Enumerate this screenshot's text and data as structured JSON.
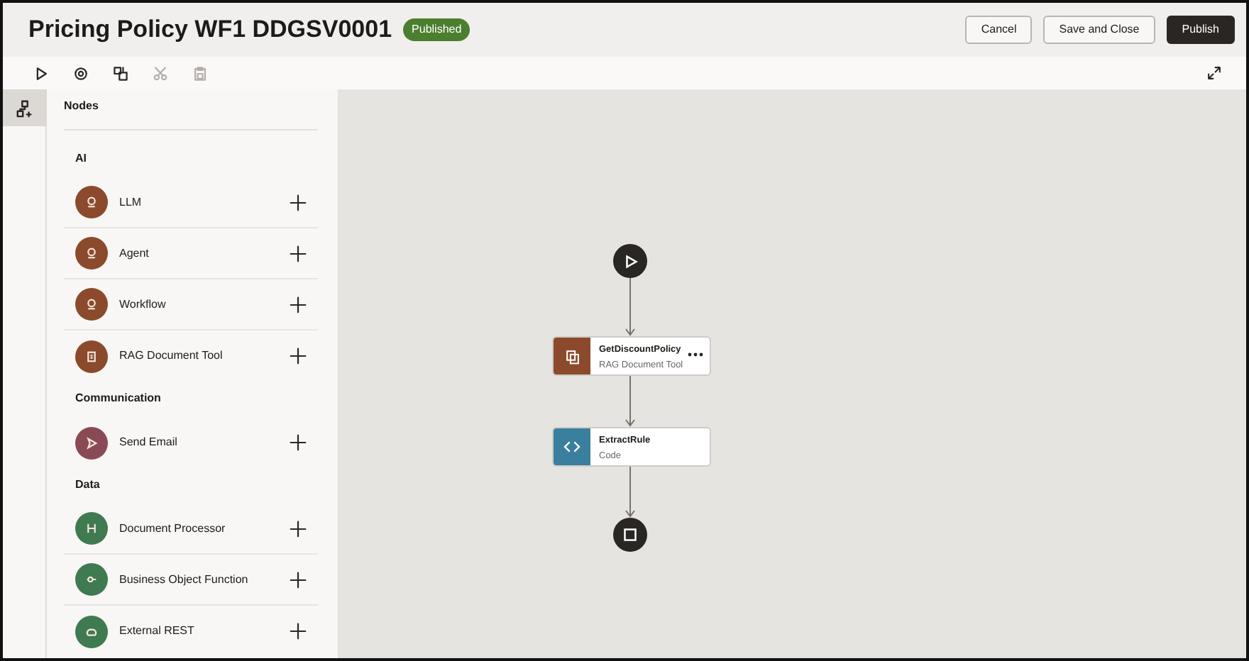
{
  "header": {
    "title": "Pricing Policy WF1 DDGSV0001",
    "status": "Published",
    "buttons": [
      {
        "label": "Cancel",
        "kind": "secondary"
      },
      {
        "label": "Save and Close",
        "kind": "secondary"
      },
      {
        "label": "Publish",
        "kind": "primary"
      }
    ]
  },
  "toolbar": {
    "tools": [
      {
        "kind": "run",
        "disabled": false
      },
      {
        "kind": "settings",
        "disabled": false
      },
      {
        "kind": "layout",
        "disabled": false
      },
      {
        "kind": "cut",
        "disabled": true
      },
      {
        "kind": "paste",
        "disabled": true
      }
    ]
  },
  "rail": [
    {
      "kind": "nodes",
      "selected": true
    }
  ],
  "palette": {
    "title": "Nodes",
    "groups": [
      {
        "title": "AI",
        "items": [
          {
            "label": "LLM",
            "color": "#8b4a2b",
            "kind": "ai"
          },
          {
            "label": "Agent",
            "color": "#8b4a2b",
            "kind": "ai"
          },
          {
            "label": "Workflow",
            "color": "#8b4a2b",
            "kind": "ai"
          },
          {
            "label": "RAG Document Tool",
            "color": "#8b4a2b",
            "kind": "doc"
          }
        ]
      },
      {
        "title": "Communication",
        "items": [
          {
            "label": "Send Email",
            "color": "#8a4a55",
            "kind": "send"
          }
        ]
      },
      {
        "title": "Data",
        "items": [
          {
            "label": "Document Processor",
            "color": "#3f7a50",
            "kind": "processor"
          },
          {
            "label": "Business Object Function",
            "color": "#3f7a50",
            "kind": "function"
          },
          {
            "label": "External REST",
            "color": "#3f7a50",
            "kind": "rest"
          }
        ]
      }
    ]
  },
  "canvas": {
    "nodes": [
      {
        "kind": "start"
      },
      {
        "kind": "rag",
        "title": "GetDiscountPolicy",
        "subtitle": "RAG Document Tool",
        "color": "#8b4a2b",
        "menu": true
      },
      {
        "kind": "code",
        "title": "ExtractRule",
        "subtitle": "Code",
        "color": "#3a7f9e",
        "menu": false
      },
      {
        "kind": "end"
      }
    ]
  }
}
